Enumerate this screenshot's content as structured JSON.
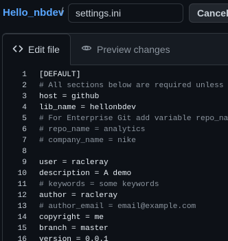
{
  "header": {
    "repo_name": "Hello_nbdev",
    "separator": "/",
    "filename": "settings.ini",
    "cancel_label": "Cancel"
  },
  "tabs": [
    {
      "label": "Edit file",
      "icon": "code-icon",
      "active": true
    },
    {
      "label": "Preview changes",
      "icon": "eye-icon",
      "active": false
    }
  ],
  "code": {
    "lines": [
      {
        "num": "1",
        "text": "[DEFAULT]",
        "comment": false
      },
      {
        "num": "2",
        "text": "# All sections below are required unless otherw",
        "comment": true
      },
      {
        "num": "3",
        "text": "host = github",
        "comment": false
      },
      {
        "num": "4",
        "text": "lib_name = hellonbdev",
        "comment": false
      },
      {
        "num": "5",
        "text": "# For Enterprise Git add variable repo_name and",
        "comment": true
      },
      {
        "num": "6",
        "text": "# repo_name = analytics",
        "comment": true
      },
      {
        "num": "7",
        "text": "# company_name = nike",
        "comment": true
      },
      {
        "num": "8",
        "text": "",
        "comment": false
      },
      {
        "num": "9",
        "text": "user = racleray",
        "comment": false
      },
      {
        "num": "10",
        "text": "description = A demo",
        "comment": false
      },
      {
        "num": "11",
        "text": "# keywords = some keywords",
        "comment": true
      },
      {
        "num": "12",
        "text": "author = racleray",
        "comment": false
      },
      {
        "num": "13",
        "text": "# author_email = email@example.com",
        "comment": true
      },
      {
        "num": "14",
        "text": "copyright = me",
        "comment": false
      },
      {
        "num": "15",
        "text": "branch = master",
        "comment": false
      },
      {
        "num": "16",
        "text": "version = 0.0.1",
        "comment": false
      }
    ]
  },
  "colors": {
    "background": "#0d1117",
    "link": "#58a6ff",
    "comment": "#8b949e",
    "text": "#e6edf3"
  }
}
